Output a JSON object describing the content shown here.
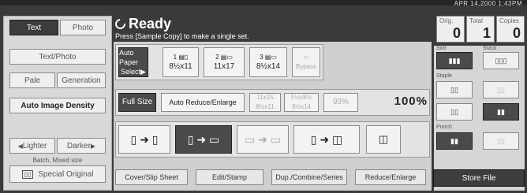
{
  "header": {
    "datetime": "APR  14,2000  1:43PM",
    "status": "Ready",
    "message": "Press [Sample Copy] to make a single set."
  },
  "counters": [
    {
      "label": "Orig.",
      "value": "0"
    },
    {
      "label": "Total",
      "value": "1"
    },
    {
      "label": "Copies",
      "value": "0"
    }
  ],
  "left": {
    "text": "Text",
    "photo": "Photo",
    "text_photo": "Text/Photo",
    "pale": "Pale",
    "generation": "Generation",
    "auto_density": "Auto Image Density",
    "lighter": "Lighter",
    "darker": "Darker",
    "batch_label": "Batch, Mixed size",
    "special_original": "Special Original"
  },
  "paper": {
    "auto_select_line1": "Auto Paper",
    "auto_select_line2": "Select▶",
    "trays": [
      {
        "num": "1",
        "size": "8½x11"
      },
      {
        "num": "2",
        "size": "11x17"
      },
      {
        "num": "3",
        "size": "8½x14"
      },
      {
        "num": "",
        "size": "Bypass"
      }
    ]
  },
  "ratio": {
    "full_size": "Full Size",
    "auto_reduce": "Auto Reduce/Enlarge",
    "r1a": "11x15",
    "r1b": "8½x11",
    "r2a": "5½x8½",
    "r2b": "8½x14",
    "r3": "93%",
    "current": "100%"
  },
  "functions": {
    "cover_slip": "Cover/Slip Sheet",
    "edit_stamp": "Edit/Stamp",
    "dup_combine": "Dup./Combine/Series",
    "reduce_enlarge": "Reduce/Enlarge",
    "store_file": "Store File"
  },
  "finish": {
    "sort": "Sort",
    "stack": "Stack",
    "staple": "Staple",
    "punch": "Punch"
  }
}
